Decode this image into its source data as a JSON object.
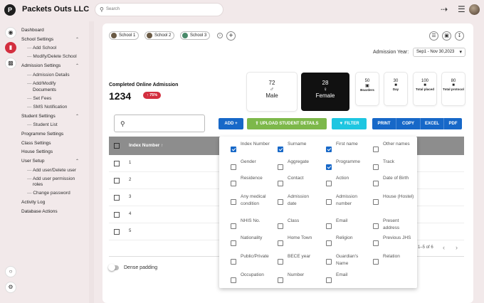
{
  "app": {
    "logo_letter": "P",
    "title": "Packets Outs LLC"
  },
  "search": {
    "placeholder": "Search"
  },
  "topbar": {
    "exit_icon": "sign-out-icon",
    "menu_icon": "hamburger-icon",
    "avatar": "user-avatar"
  },
  "rail": [
    "school-hat-icon",
    "document-icon",
    "admin-icon",
    "chat-icon",
    "gear-icon"
  ],
  "sidebar": {
    "items": [
      {
        "label": "Dashboard",
        "type": "top"
      },
      {
        "label": "School Settings",
        "type": "top",
        "expanded": true
      },
      {
        "label": "Add School",
        "type": "sub"
      },
      {
        "label": "Modify/Delete School",
        "type": "sub"
      },
      {
        "label": "Admission Settings",
        "type": "top",
        "expanded": true
      },
      {
        "label": "Admission Details",
        "type": "sub"
      },
      {
        "label": "Add/Modify",
        "label2": "Documents",
        "type": "sub"
      },
      {
        "label": "Set Fees",
        "type": "sub"
      },
      {
        "label": "SMS Notification",
        "type": "sub"
      },
      {
        "label": "Student Settings",
        "type": "top",
        "expanded": true
      },
      {
        "label": "Student List",
        "type": "sub"
      },
      {
        "label": "Programme Settings",
        "type": "top"
      },
      {
        "label": "Class Settings",
        "type": "top"
      },
      {
        "label": "House Settings",
        "type": "top"
      },
      {
        "label": "User Setup",
        "type": "top",
        "expanded": true
      },
      {
        "label": "Add user/Delete user",
        "type": "sub"
      },
      {
        "label": "Add user permission",
        "label2": "roles",
        "type": "sub"
      },
      {
        "label": "Change password",
        "type": "sub"
      },
      {
        "label": "Activity Log",
        "type": "top"
      },
      {
        "label": "Database Actions",
        "type": "top"
      }
    ]
  },
  "schools": [
    "School 1",
    "School 2",
    "School 3"
  ],
  "admission_year": {
    "label": "Admission Year:",
    "value": "Sep1 - Nov 30,2023"
  },
  "completed": {
    "title": "Completed Online Admission",
    "count": "1234",
    "change": "↑ 75%"
  },
  "stats": [
    {
      "value": "72",
      "symbol": "♂",
      "label": "Male"
    },
    {
      "value": "28",
      "symbol": "♀",
      "label": "Female"
    },
    {
      "value": "50",
      "symbol": "▣",
      "label": "Boarders"
    },
    {
      "value": "30",
      "symbol": "■",
      "label": "Day"
    },
    {
      "value": "100",
      "symbol": "■",
      "label": "Total placed"
    },
    {
      "value": "80",
      "symbol": "■",
      "label": "Total protocol"
    }
  ],
  "buttons": {
    "add": "ADD +",
    "upload": "UPLOAD STUDENT DETAILS",
    "filter": "FILTER",
    "print": "PRINT",
    "copy": "COPY",
    "excel": "EXCEL",
    "pdf": "PDF"
  },
  "table": {
    "column": "Index Number ↑",
    "rows": [
      "1",
      "2",
      "3",
      "4",
      "5"
    ],
    "pager": "1–5 of 6"
  },
  "dense_padding": "Dense padding",
  "columns_popup": [
    {
      "label": "Index Number",
      "checked": true
    },
    {
      "label": "Surname",
      "checked": true
    },
    {
      "label": "First name",
      "checked": true
    },
    {
      "label": "Other names",
      "checked": false
    },
    {
      "label": "Gender",
      "checked": false
    },
    {
      "label": "Aggregate",
      "checked": false
    },
    {
      "label": "Programme",
      "checked": true
    },
    {
      "label": "Track",
      "checked": false
    },
    {
      "label": "Residence",
      "checked": false
    },
    {
      "label": "Contact",
      "checked": false
    },
    {
      "label": "Action",
      "checked": false
    },
    {
      "label": "Date of Birth",
      "checked": false
    },
    {
      "label": "Any medical condition",
      "checked": false
    },
    {
      "label": "Admission date",
      "checked": false
    },
    {
      "label": "Admission number",
      "checked": false
    },
    {
      "label": "House (Hostel)",
      "checked": false
    },
    {
      "label": "NHIS No.",
      "checked": false
    },
    {
      "label": "Class",
      "checked": false
    },
    {
      "label": "Email",
      "checked": false
    },
    {
      "label": "Present address",
      "checked": false
    },
    {
      "label": "Nationality",
      "checked": false
    },
    {
      "label": "Home Town",
      "checked": false
    },
    {
      "label": "Religion",
      "checked": false
    },
    {
      "label": "Previous JHS",
      "checked": false
    },
    {
      "label": "Public/Private",
      "checked": false
    },
    {
      "label": "BECE year",
      "checked": false
    },
    {
      "label": "Guardian's Name",
      "checked": false
    },
    {
      "label": "Relation",
      "checked": false
    },
    {
      "label": "Occupation",
      "checked": false
    },
    {
      "label": "Number",
      "checked": false
    },
    {
      "label": "Email",
      "checked": false
    }
  ]
}
